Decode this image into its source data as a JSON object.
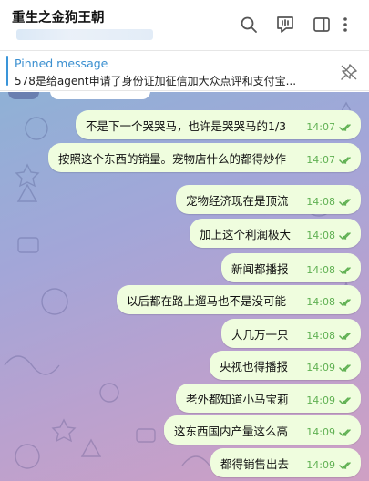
{
  "header": {
    "title": "重生之金狗王朝"
  },
  "pinned": {
    "label": "Pinned message",
    "text": "578是给agent申请了身份证加征信加大众点评和支付宝..."
  },
  "messages": [
    {
      "text": "不是下一个哭哭马，也许是哭哭马的1/3",
      "time": "14:07"
    },
    {
      "text": "按照这个东西的销量。宠物店什么的都得炒作",
      "time": "14:07"
    },
    {
      "text": "宠物经济现在是顶流",
      "time": "14:08"
    },
    {
      "text": "加上这个利润极大",
      "time": "14:08"
    },
    {
      "text": "新闻都播报",
      "time": "14:08"
    },
    {
      "text": "以后都在路上遛马也不是没可能",
      "time": "14:08"
    },
    {
      "text": "大几万一只",
      "time": "14:08"
    },
    {
      "text": "央视也得播报",
      "time": "14:09"
    },
    {
      "text": "老外都知道小马宝莉",
      "time": "14:09"
    },
    {
      "text": "这东西国内产量这么高",
      "time": "14:09"
    },
    {
      "text": "都得销售出去",
      "time": "14:09"
    }
  ],
  "colors": {
    "bubble": "#effdde",
    "time": "#5fb052",
    "accent": "#3a95d9"
  },
  "icons": [
    "search-icon",
    "video-chat-icon",
    "sidebar-icon",
    "more-icon",
    "unpin-icon",
    "double-check-icon"
  ]
}
